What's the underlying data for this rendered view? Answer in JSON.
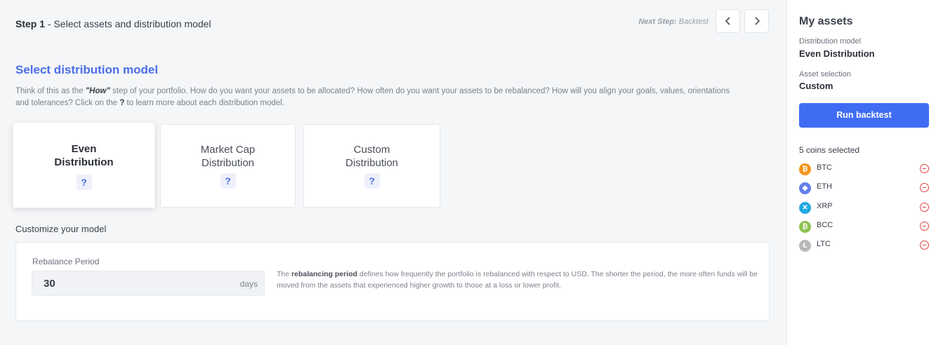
{
  "header": {
    "step_label": "Step 1",
    "step_text": " - Select assets and distribution model",
    "next_step_label": "Next Step:",
    "next_step_value": " Backtest"
  },
  "section": {
    "title": "Select distribution model",
    "desc_part1": "Think of this as the ",
    "desc_emph": "\"How\"",
    "desc_part2": " step of your portfolio. How do you want your assets to be allocated? How often do you want your assets to be rebalanced? How will you align your goals, values, orientations and tolerances? Click on the ",
    "desc_q": "?",
    "desc_part3": " to learn more about each distribution model."
  },
  "models": [
    {
      "line1": "Even",
      "line2": "Distribution",
      "help": "?",
      "selected": true
    },
    {
      "line1": "Market Cap",
      "line2": "Distribution",
      "help": "?",
      "selected": false
    },
    {
      "line1": "Custom",
      "line2": "Distribution",
      "help": "?",
      "selected": false
    }
  ],
  "customize": {
    "title": "Customize your model",
    "rebalance_label": "Rebalance Period",
    "rebalance_value": "30",
    "rebalance_unit": "days",
    "desc_part1": "The ",
    "desc_bold": "rebalancing period",
    "desc_part2": " defines how frequently the portfolio is rebalanced with respect to USD. The shorter the period, the more often funds will be moved from the assets that experienced higher growth to those at a loss or lower profit."
  },
  "sidebar": {
    "title": "My assets",
    "dist_label": "Distribution model",
    "dist_value": "Even Distribution",
    "asset_label": "Asset selection",
    "asset_value": "Custom",
    "run_button": "Run backtest",
    "coins_count": "5 coins selected",
    "coins": [
      {
        "name": "BTC",
        "icon": "bitcoin-icon",
        "glyph": "₿",
        "color": "#f7931a"
      },
      {
        "name": "ETH",
        "icon": "ethereum-icon",
        "glyph": "◆",
        "color": "#627eea"
      },
      {
        "name": "XRP",
        "icon": "ripple-icon",
        "glyph": "✕",
        "color": "#23a8e0"
      },
      {
        "name": "BCC",
        "icon": "bitconnect-icon",
        "glyph": "₿",
        "color": "#8dc351"
      },
      {
        "name": "LTC",
        "icon": "litecoin-icon",
        "glyph": "Ł",
        "color": "#b8b8b8"
      }
    ]
  }
}
